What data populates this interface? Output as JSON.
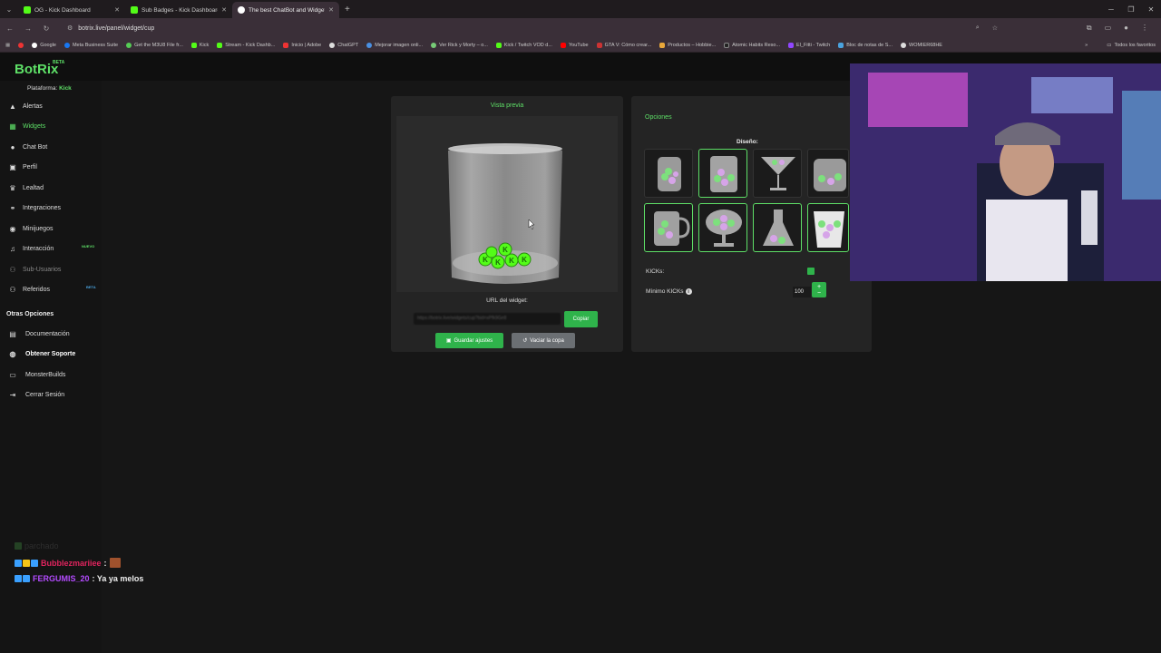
{
  "browser": {
    "tabs": [
      {
        "label": "OG - Kick Dashboard",
        "fav_color": "#53fc18",
        "active": false
      },
      {
        "label": "Sub Badges - Kick Dashboard",
        "fav_color": "#53fc18",
        "active": false
      },
      {
        "label": "The best ChatBot and Widgets",
        "fav_color": "#ffffff",
        "active": true
      }
    ],
    "url": "botrix.live/panel/widget/cup",
    "bookmarks": [
      "Google",
      "Meta Business Suite",
      "Get the M3U8 File fr...",
      "Kick",
      "Stream - Kick Dashb...",
      "Inicio | Adobe",
      "ChatGPT",
      "Mejorar imagen onli...",
      "Ver Rick y Morty – o...",
      "Kick / Twitch VOD d...",
      "YouTube",
      "GTA V: Cómo crear...",
      "Productos – Hobbie...",
      "Atomic Habits Reso...",
      "El_Fitti - Twitch",
      "Bloc de notas de S...",
      "WOMIER68HE"
    ],
    "bookmarks_all": "Todos los favoritos"
  },
  "app": {
    "logo": "BotRix",
    "logo_badge": "BETA",
    "platform_label": "Plataforma:",
    "platform_value": "Kick"
  },
  "sidebar": {
    "items": [
      {
        "label": "Alertas",
        "icon": "warning-icon"
      },
      {
        "label": "Widgets",
        "icon": "grid-icon",
        "active": true
      },
      {
        "label": "Chat Bot",
        "icon": "chat-icon"
      },
      {
        "label": "Perfil",
        "icon": "profile-icon"
      },
      {
        "label": "Lealtad",
        "icon": "trophy-icon"
      },
      {
        "label": "Integraciones",
        "icon": "link-icon"
      },
      {
        "label": "Minijuegos",
        "icon": "gamepad-icon"
      },
      {
        "label": "Interacción",
        "icon": "music-icon",
        "badge": "NUEVO"
      },
      {
        "label": "Sub-Usuarios",
        "icon": "users-icon",
        "dim": true
      },
      {
        "label": "Referidos",
        "icon": "users-icon",
        "badge": "BETA"
      }
    ],
    "other_title": "Otras Opciones",
    "other_items": [
      {
        "label": "Documentación",
        "icon": "document-icon"
      },
      {
        "label": "Obtener Soporte",
        "icon": "support-icon"
      },
      {
        "label": "MonsterBuilds",
        "icon": "monitor-icon"
      },
      {
        "label": "Cerrar Sesión",
        "icon": "logout-icon"
      }
    ]
  },
  "preview": {
    "title": "Vista previa",
    "url_label": "URL del widget:",
    "url_value": "https://botrix.live/widgets/cup?bid=xPfk9Ge8",
    "copy_label": "Copiar",
    "save_label": "Guardar ajustes",
    "empty_label": "Vaciar la copa"
  },
  "options": {
    "title": "Opciones",
    "design_label": "Diseño:",
    "designs": [
      "jar",
      "glass",
      "martini",
      "jar-wide",
      "mug",
      "goblet",
      "flask",
      "bucket"
    ],
    "selected_design": "glass",
    "kicks_label": "KICKs:",
    "kicks_enabled": true,
    "min_label": "Mínimo KICKs",
    "min_value": "100"
  },
  "chat": [
    {
      "user": "",
      "text": "parchado",
      "faded": true
    },
    {
      "user": "Bubblezmariiee",
      "user_color": "#e0245e",
      "text": ":"
    },
    {
      "user": "FERGUMIS_20",
      "user_color": "#b44bff",
      "text": ": Ya ya melos"
    }
  ],
  "colors": {
    "accent": "#5ee067",
    "button_green": "#2fb34b",
    "button_gray": "#6b6f73"
  }
}
